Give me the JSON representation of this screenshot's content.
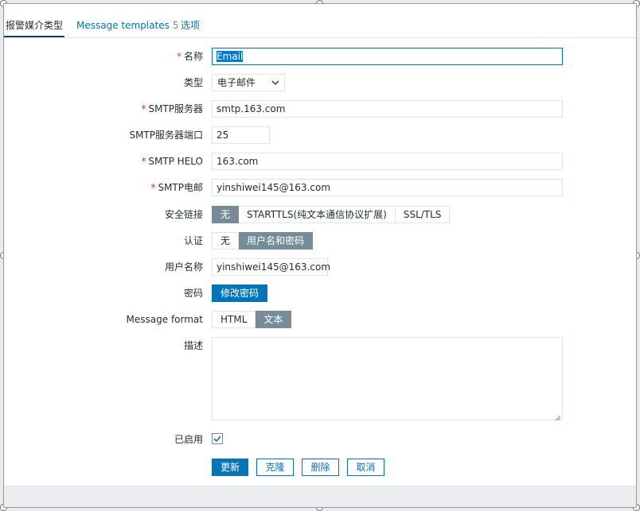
{
  "tabs": [
    {
      "label": "报警媒介类型",
      "active": true
    },
    {
      "label": "Message templates",
      "count": "5",
      "active": false
    },
    {
      "label": "选项",
      "active": false
    }
  ],
  "form": {
    "name": {
      "label": "名称",
      "required": true,
      "value": "Email"
    },
    "type": {
      "label": "类型",
      "value": "电子邮件"
    },
    "smtp_server": {
      "label": "SMTP服务器",
      "required": true,
      "value": "smtp.163.com"
    },
    "smtp_port": {
      "label": "SMTP服务器端口",
      "value": "25"
    },
    "smtp_helo": {
      "label": "SMTP HELO",
      "required": true,
      "value": "163.com"
    },
    "smtp_email": {
      "label": "SMTP电邮",
      "required": true,
      "value": "yinshiwei145@163.com"
    },
    "security": {
      "label": "安全链接",
      "options": [
        "无",
        "STARTTLS(纯文本通信协议扩展)",
        "SSL/TLS"
      ],
      "selected": "无"
    },
    "auth": {
      "label": "认证",
      "options": [
        "无",
        "用户名和密码"
      ],
      "selected": "用户名和密码"
    },
    "username": {
      "label": "用户名称",
      "value": "yinshiwei145@163.com"
    },
    "password": {
      "label": "密码",
      "button": "修改密码"
    },
    "message_format": {
      "label": "Message format",
      "options": [
        "HTML",
        "文本"
      ],
      "selected": "文本"
    },
    "description": {
      "label": "描述",
      "value": ""
    },
    "enabled": {
      "label": "已启用",
      "checked": true
    }
  },
  "actions": {
    "update": "更新",
    "clone": "克隆",
    "delete": "删除",
    "cancel": "取消"
  },
  "colors": {
    "accent": "#0275b8",
    "required": "#e33734",
    "selected_segment": "#768d99",
    "text": "#1f2c33"
  }
}
